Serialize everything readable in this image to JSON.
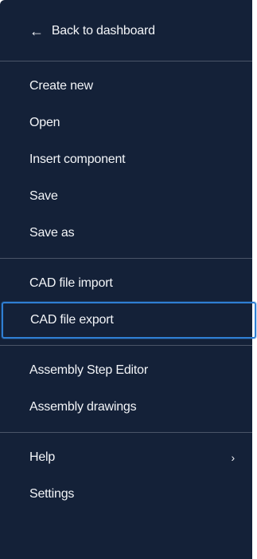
{
  "menu": {
    "back": {
      "icon": "←",
      "label": "Back to dashboard"
    },
    "file_items": [
      {
        "label": "Create new"
      },
      {
        "label": "Open"
      },
      {
        "label": "Insert component"
      },
      {
        "label": "Save"
      },
      {
        "label": "Save as"
      }
    ],
    "cad_items": [
      {
        "label": "CAD file import"
      },
      {
        "label": "CAD file export"
      }
    ],
    "assembly_items": [
      {
        "label": "Assembly Step Editor"
      },
      {
        "label": "Assembly drawings"
      }
    ],
    "help": {
      "label": "Help",
      "chevron": "›"
    },
    "settings": {
      "label": "Settings"
    },
    "selected_item": "CAD file export",
    "colors": {
      "background": "#142138",
      "text": "#f3f5f8",
      "divider": "#4a5568",
      "focus": "#2f7fd3"
    }
  }
}
